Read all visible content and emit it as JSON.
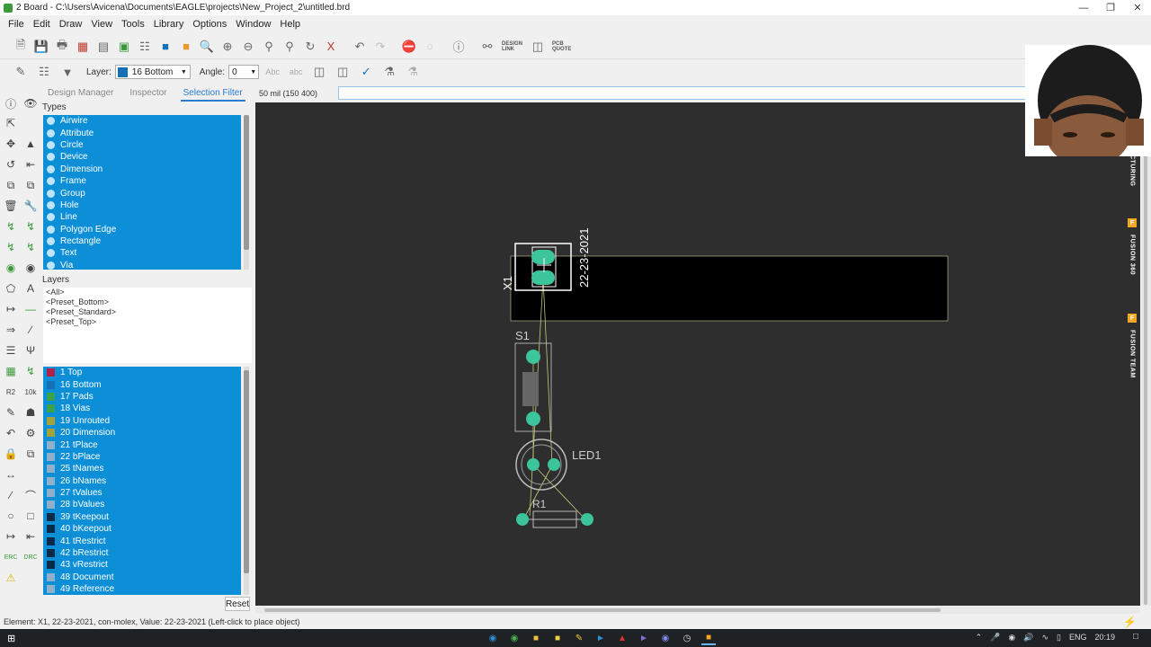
{
  "window": {
    "title": "2 Board - C:\\Users\\Avicena\\Documents\\EAGLE\\projects\\New_Project_2\\untitled.brd"
  },
  "menu": [
    "File",
    "Edit",
    "Draw",
    "View",
    "Tools",
    "Library",
    "Options",
    "Window",
    "Help"
  ],
  "toolbar": {
    "design_link": "DESIGN LINK",
    "pcb_quote": "PCB QUOTE"
  },
  "params": {
    "layer_label": "Layer:",
    "layer_value": "16 Bottom",
    "angle_label": "Angle:",
    "angle_value": "0"
  },
  "tabs": [
    {
      "label": "Design Manager",
      "active": false
    },
    {
      "label": "Inspector",
      "active": false
    },
    {
      "label": "Selection Filter",
      "active": true
    }
  ],
  "filter": {
    "types_heading": "Types",
    "types": [
      "Airwire",
      "Attribute",
      "Circle",
      "Device",
      "Dimension",
      "Frame",
      "Group",
      "Hole",
      "Line",
      "Polygon Edge",
      "Rectangle",
      "Text",
      "Via"
    ],
    "layers_heading": "Layers",
    "presets": [
      "<All>",
      "<Preset_Bottom>",
      "<Preset_Standard>",
      "<Preset_Top>"
    ],
    "layers": [
      {
        "label": "1 Top",
        "color": "#b0214a"
      },
      {
        "label": "16 Bottom",
        "color": "#1670b5"
      },
      {
        "label": "17 Pads",
        "color": "#3aa34a"
      },
      {
        "label": "18 Vias",
        "color": "#3aa34a"
      },
      {
        "label": "19 Unrouted",
        "color": "#a3a33a"
      },
      {
        "label": "20 Dimension",
        "color": "#a3a33a"
      },
      {
        "label": "21 tPlace",
        "color": "#8fb0c8"
      },
      {
        "label": "22 bPlace",
        "color": "#8fb0c8"
      },
      {
        "label": "25 tNames",
        "color": "#8fb0c8"
      },
      {
        "label": "26 bNames",
        "color": "#8fb0c8"
      },
      {
        "label": "27 tValues",
        "color": "#8fb0c8"
      },
      {
        "label": "28 bValues",
        "color": "#8fb0c8"
      },
      {
        "label": "39 tKeepout",
        "color": "#0a2a4a"
      },
      {
        "label": "40 bKeepout",
        "color": "#0a2a4a"
      },
      {
        "label": "41 tRestrict",
        "color": "#0a2a4a"
      },
      {
        "label": "42 bRestrict",
        "color": "#0a2a4a"
      },
      {
        "label": "43 vRestrict",
        "color": "#0a2a4a"
      },
      {
        "label": "48 Document",
        "color": "#8fb0c8"
      },
      {
        "label": "49 Reference",
        "color": "#8fb0c8"
      }
    ],
    "reset_label": "Reset"
  },
  "coord": "50 mil (150 400)",
  "board": {
    "x1_label": "X1",
    "x1_value": "22-23-2021",
    "s1_label": "S1",
    "led_label": "LED1",
    "r1_label": "R1"
  },
  "sidetabs": [
    "CTURING",
    "FUSION 360",
    "FUSION TEAM"
  ],
  "status": "Element: X1, 22-23-2021, con-molex, Value: 22-23-2021 (Left-click to place object)",
  "taskbar": {
    "lang": "ENG",
    "time": "20:19"
  }
}
